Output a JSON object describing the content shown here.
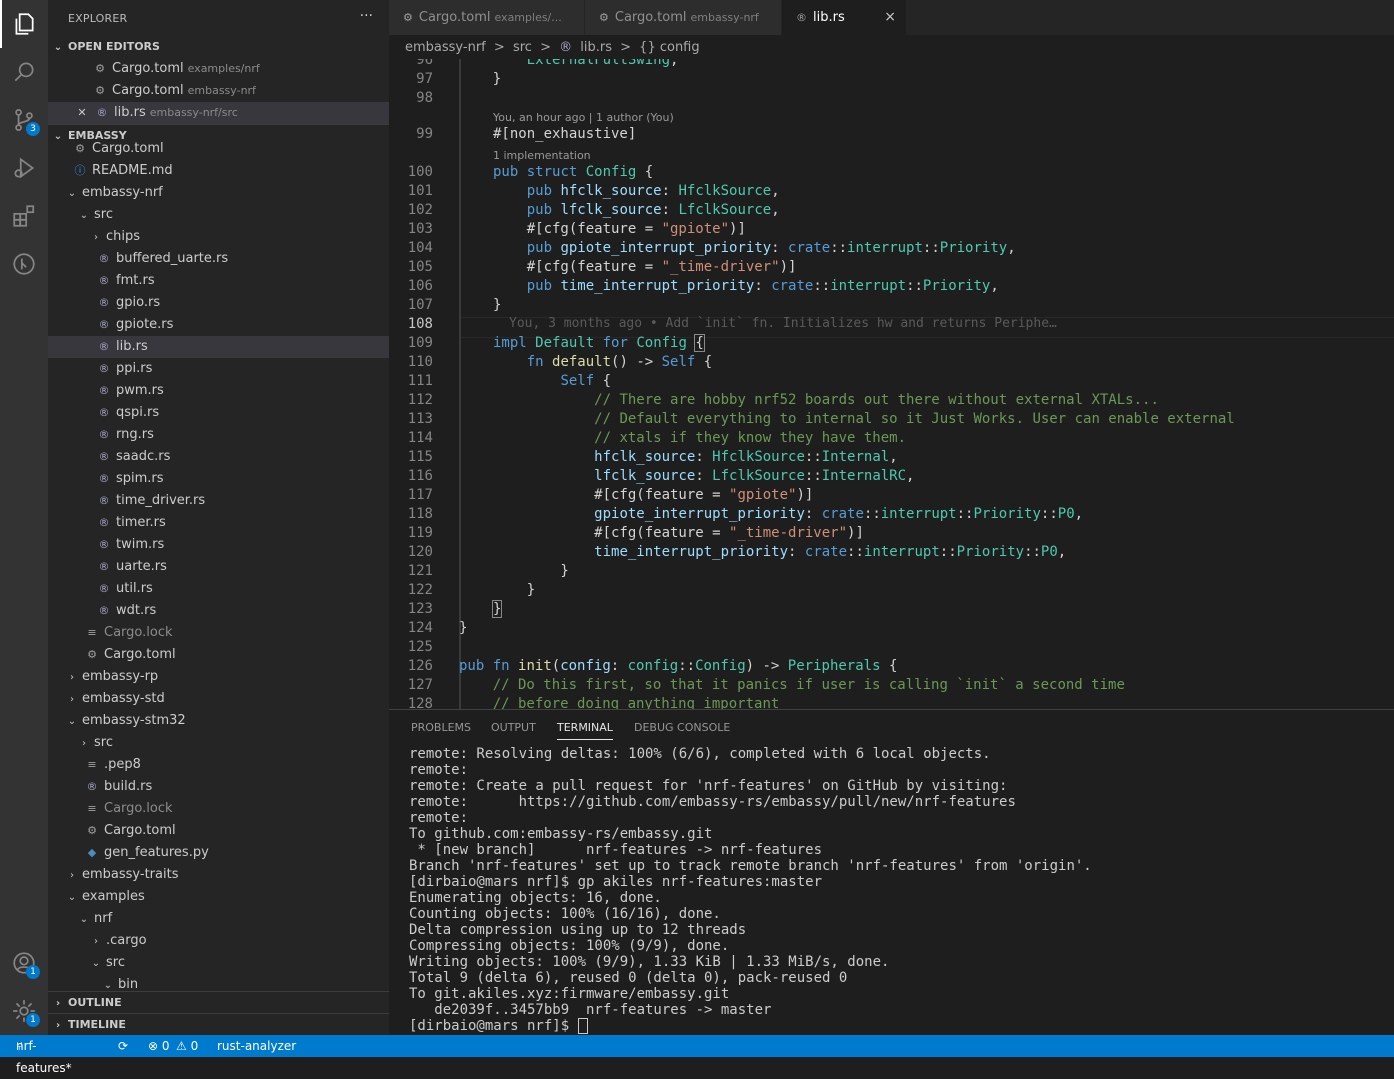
{
  "sidebar": {
    "title": "EXPLORER",
    "more": "···",
    "open_editors_header": "OPEN EDITORS",
    "open_editors": [
      {
        "name": "Cargo.toml",
        "desc": "examples/nrf"
      },
      {
        "name": "Cargo.toml",
        "desc": "embassy-nrf"
      },
      {
        "name": "lib.rs",
        "desc": "embassy-nrf/src"
      }
    ],
    "project_header": "EMBASSY",
    "tree": [
      "Cargo.toml",
      "README.md",
      "embassy-nrf",
      "src",
      "chips",
      "buffered_uarte.rs",
      "fmt.rs",
      "gpio.rs",
      "gpiote.rs",
      "lib.rs",
      "ppi.rs",
      "pwm.rs",
      "qspi.rs",
      "rng.rs",
      "saadc.rs",
      "spim.rs",
      "time_driver.rs",
      "timer.rs",
      "twim.rs",
      "uarte.rs",
      "util.rs",
      "wdt.rs",
      "Cargo.lock",
      "Cargo.toml",
      "embassy-rp",
      "embassy-std",
      "embassy-stm32",
      "src",
      ".pep8",
      "build.rs",
      "Cargo.lock",
      "Cargo.toml",
      "gen_features.py",
      "embassy-traits",
      "examples",
      "nrf",
      ".cargo",
      "src",
      "bin"
    ],
    "outline_header": "OUTLINE",
    "timeline_header": "TIMELINE"
  },
  "activity": {
    "scm_badge": "3",
    "accounts_badge": "1",
    "settings_badge": "1"
  },
  "tabs": [
    {
      "name": "Cargo.toml",
      "desc": "examples/..."
    },
    {
      "name": "Cargo.toml",
      "desc": "embassy-nrf"
    },
    {
      "name": "lib.rs",
      "desc": ""
    }
  ],
  "tab_close": "×",
  "breadcrumb": [
    "embassy-nrf",
    ">",
    "src",
    ">",
    "lib.rs",
    ">",
    "{} config"
  ],
  "editor": {
    "line_numbers": [
      "96",
      "97",
      "98",
      "99",
      "100",
      "101",
      "102",
      "103",
      "104",
      "105",
      "106",
      "107",
      "108",
      "109",
      "110",
      "111",
      "112",
      "113",
      "114",
      "115",
      "116",
      "117",
      "118",
      "119",
      "120",
      "121",
      "122",
      "123",
      "124",
      "125",
      "126",
      "127",
      "128"
    ],
    "lens_blame": "You, an hour ago | 1 author (You)",
    "lens_impl": "1 implementation",
    "inline_blame": "You, 3 months ago • Add `init` fn. Initializes hw and returns Periphe…"
  },
  "panel": {
    "tabs": [
      "PROBLEMS",
      "OUTPUT",
      "TERMINAL",
      "DEBUG CONSOLE"
    ],
    "terminal_lines": [
      "remote: Resolving deltas: 100% (6/6), completed with 6 local objects.",
      "remote:",
      "remote: Create a pull request for 'nrf-features' on GitHub by visiting:",
      "remote:      https://github.com/embassy-rs/embassy/pull/new/nrf-features",
      "remote:",
      "To github.com:embassy-rs/embassy.git",
      " * [new branch]      nrf-features -> nrf-features",
      "Branch 'nrf-features' set up to track remote branch 'nrf-features' from 'origin'.",
      "[dirbaio@mars nrf]$ gp akiles nrf-features:master",
      "Enumerating objects: 16, done.",
      "Counting objects: 100% (16/16), done.",
      "Delta compression using up to 12 threads",
      "Compressing objects: 100% (9/9), done.",
      "Writing objects: 100% (9/9), 1.33 KiB | 1.33 MiB/s, done.",
      "Total 9 (delta 6), reused 0 (delta 0), pack-reused 0",
      "To git.akiles.xyz:firmware/embassy.git",
      "   de2039f..3457bb9  nrf-features -> master"
    ],
    "prompt": "[dirbaio@mars nrf]$ "
  },
  "status": {
    "branch": "nrf-features*",
    "sync": "⟳",
    "errors": "⊗ 0",
    "warnings": "⚠ 0",
    "analyzer": "rust-analyzer"
  }
}
